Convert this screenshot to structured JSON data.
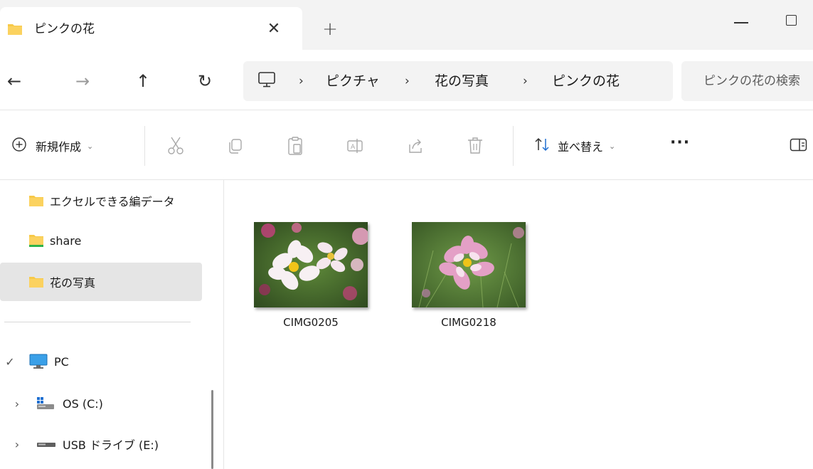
{
  "tab": {
    "title": "ピンクの花",
    "close": "✕",
    "new_tab": "+"
  },
  "nav": {
    "back": "←",
    "forward": "→",
    "up": "↑",
    "refresh": "↻"
  },
  "breadcrumb": [
    "ピクチャ",
    "花の写真",
    "ピンクの花"
  ],
  "breadcrumb_separator": "›",
  "search": {
    "placeholder": "ピンクの花の検索"
  },
  "toolbar": {
    "new_label": "新規作成",
    "sort_label": "並べ替え",
    "more_label": "···",
    "icons": [
      "cut-icon",
      "copy-icon",
      "paste-icon",
      "rename-icon",
      "share-icon",
      "delete-icon"
    ]
  },
  "sidebar": {
    "items": [
      {
        "label": "エクセルできる編データ",
        "icon": "folder-icon"
      },
      {
        "label": "share",
        "icon": "shared-folder-icon"
      },
      {
        "label": "花の写真",
        "icon": "folder-icon",
        "selected": true
      }
    ],
    "drives": [
      {
        "label": "PC",
        "icon": "pc-icon",
        "expander": "✓"
      },
      {
        "label": "OS (C:)",
        "icon": "system-drive-icon",
        "expander": "›"
      },
      {
        "label": "USB ドライブ (E:)",
        "icon": "usb-drive-icon",
        "expander": "›"
      }
    ]
  },
  "files": [
    {
      "name": "CIMG0205",
      "thumbnail": "white-cosmos-flowers"
    },
    {
      "name": "CIMG0218",
      "thumbnail": "pink-cosmos-flower"
    }
  ],
  "colors": {
    "folder": "#f7c948",
    "pc_icon": "#3aa0e8",
    "selected_bg": "#e5e5e5"
  }
}
